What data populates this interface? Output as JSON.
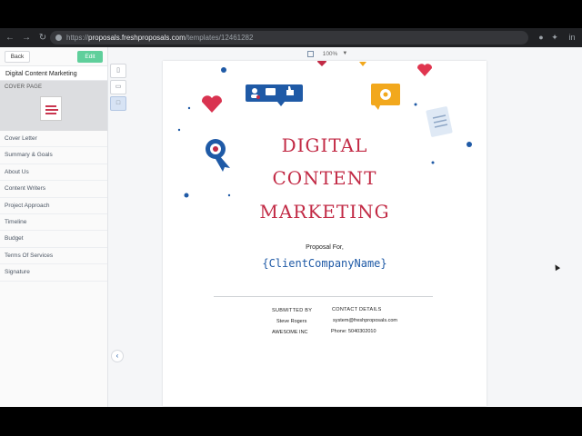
{
  "browser": {
    "url_scheme": "https://",
    "url_host": "proposals.freshproposals.com",
    "url_path": "/templates/12461282",
    "profile_label": "in"
  },
  "sidebar": {
    "back_label": "Back",
    "edit_label": "Edit",
    "document_title": "Digital Content Marketing",
    "cover_label": "COVER PAGE",
    "items": [
      "Cover Letter",
      "Summary & Goals",
      "About Us",
      "Content Writers",
      "Project Approach",
      "Timeline",
      "Budget",
      "Terms Of Services",
      "Signature"
    ]
  },
  "toolbar": {
    "zoom": "100%"
  },
  "document": {
    "headline": [
      "DIGITAL",
      "CONTENT",
      "MARKETING"
    ],
    "proposal_for": "Proposal For,",
    "client_placeholder": "{ClientCompanyName}",
    "submitted_by_label": "SUBMITTED BY",
    "submitter_name": "Steve Rogers",
    "submitter_company": "AWESOME INC",
    "contact_label": "CONTACT DETAILS",
    "contact_email": "system@freshproposals.com",
    "contact_phone": "Phone: 5040302010"
  },
  "colors": {
    "accent_red": "#c22a45",
    "accent_blue": "#1f5aa6",
    "edit_green": "#5fcf9b",
    "icon_yellow": "#f2a81d"
  }
}
